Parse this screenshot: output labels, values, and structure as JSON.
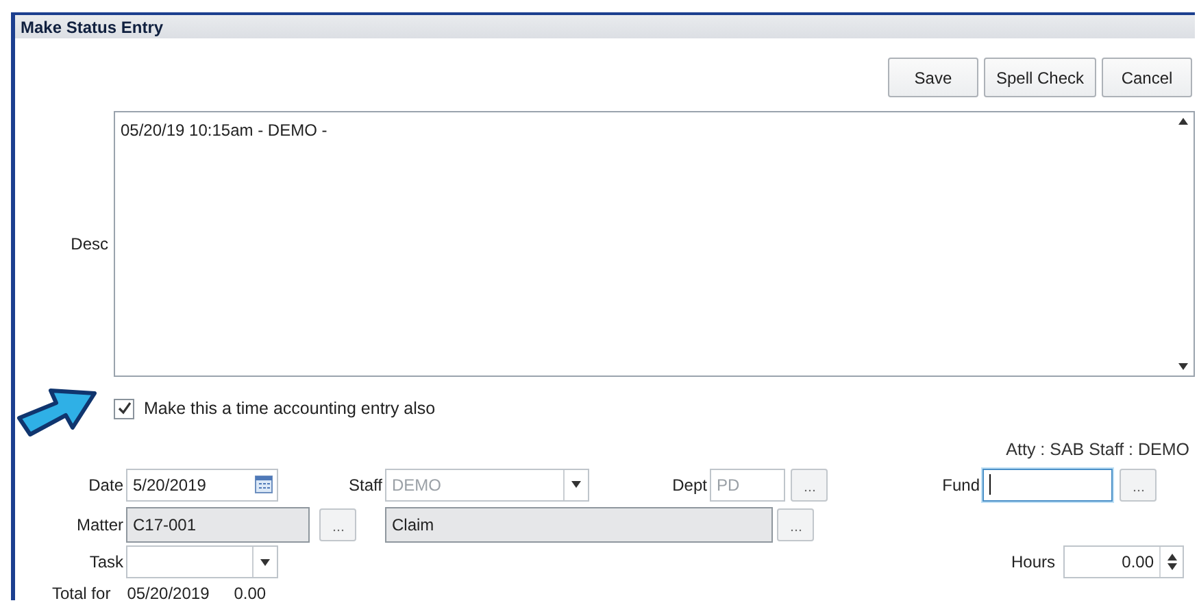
{
  "window": {
    "title": "Make Status Entry"
  },
  "buttons": [
    {
      "label": "Save"
    },
    {
      "label": "Spell Check"
    },
    {
      "label": "Cancel"
    }
  ],
  "desc": {
    "label": "Desc",
    "value": "05/20/19 10:15am - DEMO -"
  },
  "time_entry": {
    "label": "Make this a time accounting entry also",
    "checked": true
  },
  "summary": "Atty : SAB Staff : DEMO",
  "date": {
    "label": "Date",
    "value": "5/20/2019"
  },
  "staff": {
    "label": "Staff",
    "value": "DEMO",
    "disabled": true
  },
  "dept": {
    "label": "Dept",
    "value": "PD",
    "disabled": true
  },
  "fund": {
    "label": "Fund",
    "focused": true
  },
  "matter": {
    "label": "Matter",
    "value": "C17-001",
    "readonly": true
  },
  "matter_name": {
    "value": "Claim",
    "readonly": true
  },
  "task": {
    "label": "Task"
  },
  "hours": {
    "label": "Hours",
    "value": "0.00"
  },
  "total": {
    "label": "Total for",
    "date": "05/20/2019",
    "amount": "0.00"
  }
}
